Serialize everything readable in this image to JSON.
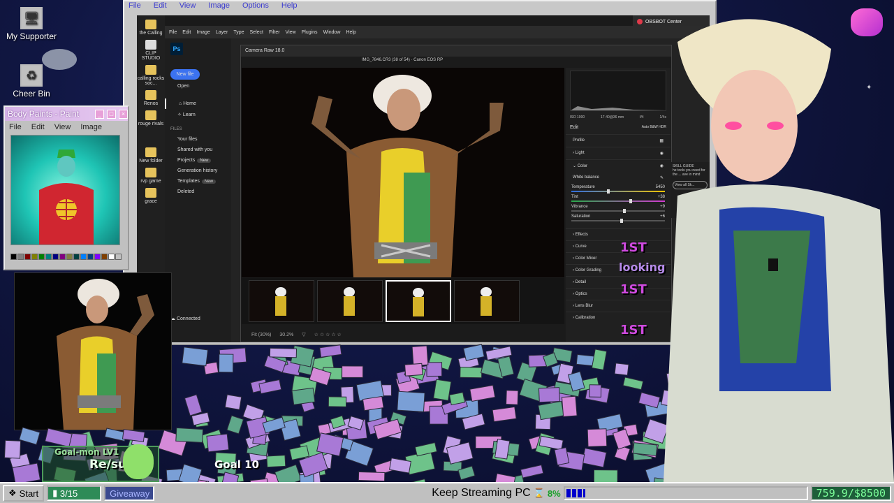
{
  "desktop": {
    "icons": [
      {
        "label": "My Supporter",
        "icon": "computer-icon"
      },
      {
        "label": "Cheer Bin",
        "icon": "recycle-bin-icon"
      }
    ]
  },
  "paint_window": {
    "title": "Body Paints - Paint",
    "menu": [
      "File",
      "Edit",
      "View",
      "Image"
    ],
    "palette": [
      "#000000",
      "#808080",
      "#800000",
      "#808000",
      "#008000",
      "#008080",
      "#000080",
      "#800080",
      "#808040",
      "#004040",
      "#0080ff",
      "#004080",
      "#8000ff",
      "#804000",
      "#ffffff",
      "#c0c0c0",
      "#ff0000",
      "#ffff00",
      "#00ff00",
      "#00ffff",
      "#0000ff",
      "#ff00ff"
    ]
  },
  "outer_window": {
    "menu": [
      "File",
      "Edit",
      "View",
      "Image",
      "Options",
      "Help"
    ]
  },
  "left_strip": [
    {
      "label": "the Calling"
    },
    {
      "label": "CLIP STUDIO"
    },
    {
      "label": "calling rocks soc..."
    },
    {
      "label": "Renos"
    },
    {
      "label": "rouge rivals"
    },
    {
      "label": "New folder"
    },
    {
      "label": "rvp game"
    },
    {
      "label": "grace"
    }
  ],
  "obsbot": {
    "label": "OBSBOT Center"
  },
  "photoshop": {
    "logo": "Ps",
    "menu": [
      "File",
      "Edit",
      "Image",
      "Layer",
      "Type",
      "Select",
      "Filter",
      "View",
      "Plugins",
      "Window",
      "Help"
    ],
    "new_file": "New file",
    "open": "Open",
    "nav": [
      "Home",
      "Learn"
    ],
    "files_header": "FILES",
    "files": [
      {
        "label": "Your files",
        "badge": ""
      },
      {
        "label": "Shared with you",
        "badge": ""
      },
      {
        "label": "Projects",
        "badge": "New"
      },
      {
        "label": "Generation history",
        "badge": ""
      },
      {
        "label": "Templates",
        "badge": "New"
      },
      {
        "label": "Deleted",
        "badge": ""
      }
    ],
    "connected": "Connected"
  },
  "camera_raw": {
    "title": "Camera Raw 18.0",
    "filename": "IMG_7846.CR3 (38 of 54)  ·  Canon EOS RP",
    "meta": [
      "ISO 1000",
      "17-40@36 mm",
      "f/4",
      "1/4s"
    ],
    "edit_label": "Edit",
    "edit_modes": [
      "Auto",
      "B&W",
      "HDR"
    ],
    "profile": "Profile",
    "sections_top": [
      "Light"
    ],
    "color_section": "Color",
    "white_balance": "White balance",
    "sliders": [
      {
        "label": "Temperature",
        "value": "5450",
        "level": 0.38
      },
      {
        "label": "Tint",
        "value": "+38",
        "level": 0.62
      },
      {
        "label": "Vibrance",
        "value": "+9",
        "level": 0.55
      },
      {
        "label": "Saturation",
        "value": "+6",
        "level": 0.52
      }
    ],
    "sections": [
      "Effects",
      "Curve",
      "Color Mixer",
      "Color Grading",
      "Detail",
      "Optics",
      "Lens Blur",
      "Calibration"
    ],
    "zoom": "30.2%",
    "fit": "Fit (30%)"
  },
  "overlays": {
    "goal_title": "Goal-mon LV1",
    "goal_sub": "Re/sub",
    "goal_count": "Goal 10",
    "looking": "looking",
    "badge_text": "1ST"
  },
  "taskbar": {
    "start": "Start",
    "counter": "3/15",
    "giveaway": "Giveaway",
    "status": "Keep Streaming PC",
    "percent": "8%",
    "progress_level": 0.08,
    "money": "759.9",
    "goal_money": "$8500"
  },
  "skill_panel": {
    "header": "SKILL GUIDE",
    "text": "he tools you need for the ... ave in mind",
    "button": "View all Sk..."
  }
}
